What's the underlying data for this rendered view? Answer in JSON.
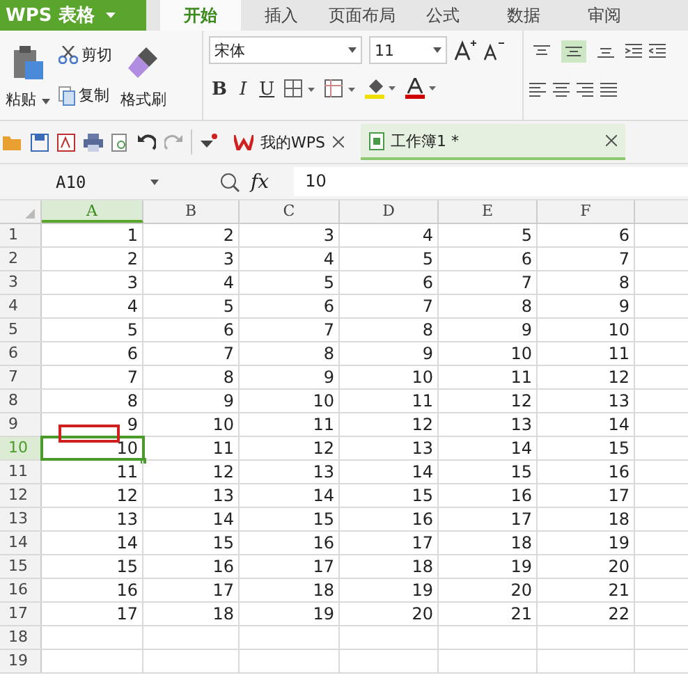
{
  "app_menu": {
    "title": "WPS 表格"
  },
  "ribbon_tabs": [
    {
      "label": "开始",
      "selected": true
    },
    {
      "label": "插入",
      "selected": false
    },
    {
      "label": "页面布局",
      "selected": false
    },
    {
      "label": "公式",
      "selected": false
    },
    {
      "label": "数据",
      "selected": false
    },
    {
      "label": "审阅",
      "selected": false
    }
  ],
  "clipboard": {
    "paste": "粘贴",
    "cut": "剪切",
    "copy": "复制",
    "format_painter": "格式刷"
  },
  "font": {
    "name": "宋体",
    "size": "11",
    "bold": "B",
    "italic": "I",
    "underline": "U"
  },
  "vertical_align": [
    {
      "selected": false
    },
    {
      "selected": true
    },
    {
      "selected": false
    }
  ],
  "document_tabs": [
    {
      "label": "我的WPS",
      "selected": false
    },
    {
      "label": "工作簿1 *",
      "selected": true
    }
  ],
  "name_box": "A10",
  "function_label": "fx",
  "formula": "10",
  "columns": [
    {
      "label": "A",
      "selected": true
    },
    {
      "label": "B",
      "selected": false
    },
    {
      "label": "C",
      "selected": false
    },
    {
      "label": "D",
      "selected": false
    },
    {
      "label": "E",
      "selected": false
    },
    {
      "label": "F",
      "selected": false
    }
  ],
  "rows": [
    {
      "header": "1",
      "selected": false,
      "cells": [
        "1",
        "2",
        "3",
        "4",
        "5",
        "6"
      ]
    },
    {
      "header": "2",
      "selected": false,
      "cells": [
        "2",
        "3",
        "4",
        "5",
        "6",
        "7"
      ]
    },
    {
      "header": "3",
      "selected": false,
      "cells": [
        "3",
        "4",
        "5",
        "6",
        "7",
        "8"
      ]
    },
    {
      "header": "4",
      "selected": false,
      "cells": [
        "4",
        "5",
        "6",
        "7",
        "8",
        "9"
      ]
    },
    {
      "header": "5",
      "selected": false,
      "cells": [
        "5",
        "6",
        "7",
        "8",
        "9",
        "10"
      ]
    },
    {
      "header": "6",
      "selected": false,
      "cells": [
        "6",
        "7",
        "8",
        "9",
        "10",
        "11"
      ]
    },
    {
      "header": "7",
      "selected": false,
      "cells": [
        "7",
        "8",
        "9",
        "10",
        "11",
        "12"
      ]
    },
    {
      "header": "8",
      "selected": false,
      "cells": [
        "8",
        "9",
        "10",
        "11",
        "12",
        "13"
      ]
    },
    {
      "header": "9",
      "selected": false,
      "cells": [
        "9",
        "10",
        "11",
        "12",
        "13",
        "14"
      ]
    },
    {
      "header": "10",
      "selected": true,
      "cells": [
        "10",
        "11",
        "12",
        "13",
        "14",
        "15"
      ]
    },
    {
      "header": "11",
      "selected": false,
      "cells": [
        "11",
        "12",
        "13",
        "14",
        "15",
        "16"
      ]
    },
    {
      "header": "12",
      "selected": false,
      "cells": [
        "12",
        "13",
        "14",
        "15",
        "16",
        "17"
      ]
    },
    {
      "header": "13",
      "selected": false,
      "cells": [
        "13",
        "14",
        "15",
        "16",
        "17",
        "18"
      ]
    },
    {
      "header": "14",
      "selected": false,
      "cells": [
        "14",
        "15",
        "16",
        "17",
        "18",
        "19"
      ]
    },
    {
      "header": "15",
      "selected": false,
      "cells": [
        "15",
        "16",
        "17",
        "18",
        "19",
        "20"
      ]
    },
    {
      "header": "16",
      "selected": false,
      "cells": [
        "16",
        "17",
        "18",
        "19",
        "20",
        "21"
      ]
    },
    {
      "header": "17",
      "selected": false,
      "cells": [
        "17",
        "18",
        "19",
        "20",
        "21",
        "22"
      ]
    },
    {
      "header": "18",
      "selected": false,
      "cells": []
    },
    {
      "header": "19",
      "selected": false,
      "cells": []
    }
  ]
}
